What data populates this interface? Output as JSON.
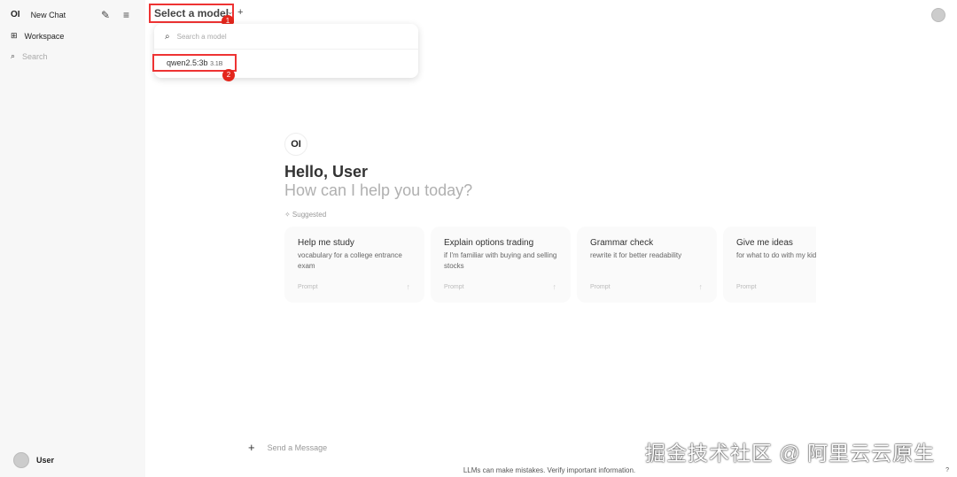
{
  "sidebar": {
    "logo": "OI",
    "new_chat": "New Chat",
    "workspace": "Workspace",
    "search": "Search",
    "user": "User"
  },
  "header": {
    "model_select": "Select a model",
    "badge1": "1",
    "badge2": "2"
  },
  "dropdown": {
    "search_placeholder": "Search a model",
    "model_name": "qwen2.5:3b",
    "model_size": "3.1B"
  },
  "hero": {
    "logo": "OI",
    "greeting": "Hello, User",
    "subtitle": "How can I help you today?",
    "suggested": "✧ Suggested"
  },
  "cards": [
    {
      "title": "Help me study",
      "desc": "vocabulary for a college entrance exam",
      "prompt": "Prompt"
    },
    {
      "title": "Explain options trading",
      "desc": "if I'm familiar with buying and selling stocks",
      "prompt": "Prompt"
    },
    {
      "title": "Grammar check",
      "desc": "rewrite it for better readability",
      "prompt": "Prompt"
    },
    {
      "title": "Give me ideas",
      "desc": "for what to do with my kids' art",
      "prompt": "Prompt"
    }
  ],
  "input": {
    "placeholder": "Send a Message"
  },
  "footer": {
    "disclaimer": "LLMs can make mistakes. Verify important information.",
    "help": "?"
  },
  "watermark": "掘金技术社区 @ 阿里云云原生"
}
